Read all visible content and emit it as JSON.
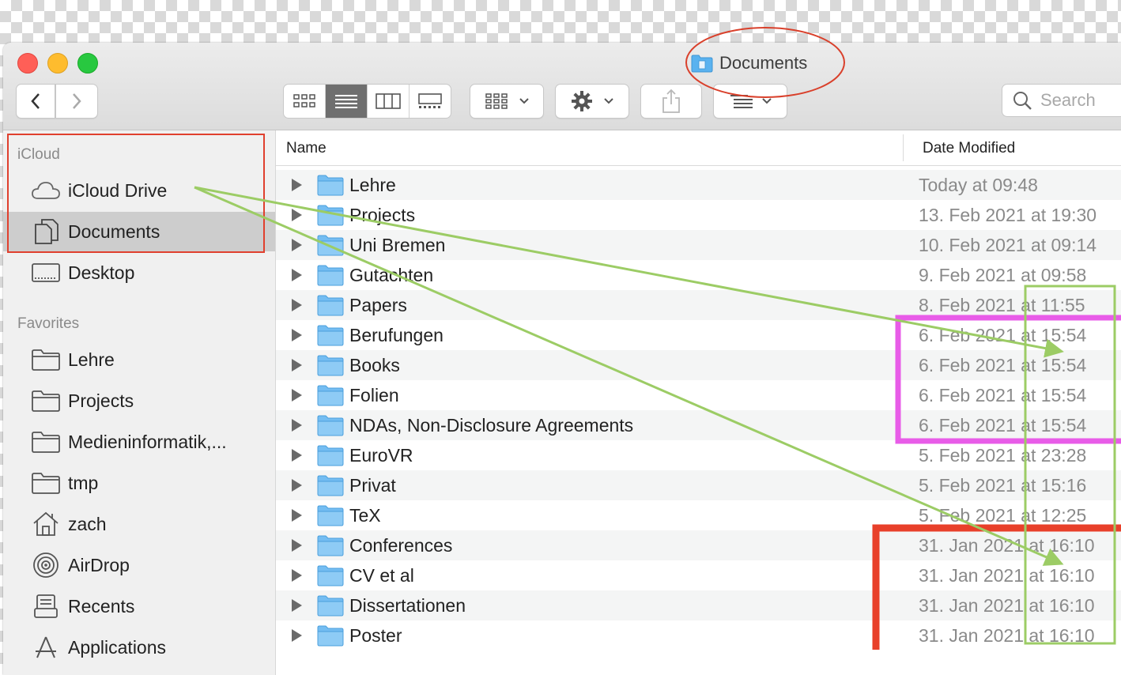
{
  "window": {
    "title": "Documents"
  },
  "toolbar": {
    "back_icon": "chevron-left-icon",
    "forward_icon": "chevron-right-icon",
    "view_modes": [
      "icon-view",
      "list-view",
      "column-view",
      "gallery-view"
    ],
    "search_placeholder": "Search"
  },
  "sidebar": {
    "icloud_header": "iCloud",
    "icloud_items": [
      {
        "label": "iCloud Drive",
        "icon": "cloud-icon"
      },
      {
        "label": "Documents",
        "icon": "documents-icon",
        "selected": true
      },
      {
        "label": "Desktop",
        "icon": "desktop-icon"
      }
    ],
    "favorites_header": "Favorites",
    "favorite_items": [
      {
        "label": "Lehre",
        "icon": "folder-icon"
      },
      {
        "label": "Projects",
        "icon": "folder-icon"
      },
      {
        "label": "Medieninformatik,...",
        "icon": "folder-icon"
      },
      {
        "label": "tmp",
        "icon": "folder-icon"
      },
      {
        "label": "zach",
        "icon": "home-icon"
      },
      {
        "label": "AirDrop",
        "icon": "airdrop-icon"
      },
      {
        "label": "Recents",
        "icon": "recents-icon"
      },
      {
        "label": "Applications",
        "icon": "applications-icon"
      }
    ]
  },
  "columns": {
    "name": "Name",
    "date_modified": "Date Modified"
  },
  "files": [
    {
      "name": "Lehre",
      "date": "Today at 09:48"
    },
    {
      "name": "Projects",
      "date": "13. Feb 2021 at 19:30"
    },
    {
      "name": "Uni Bremen",
      "date": "10. Feb 2021 at 09:14"
    },
    {
      "name": "Gutachten",
      "date": "9. Feb 2021 at 09:58"
    },
    {
      "name": "Papers",
      "date": "8. Feb 2021 at 11:55"
    },
    {
      "name": "Berufungen",
      "date": "6. Feb 2021 at 15:54"
    },
    {
      "name": "Books",
      "date": "6. Feb 2021 at 15:54"
    },
    {
      "name": "Folien",
      "date": "6. Feb 2021 at 15:54"
    },
    {
      "name": "NDAs, Non-Disclosure Agreements",
      "date": "6. Feb 2021 at 15:54"
    },
    {
      "name": "EuroVR",
      "date": "5. Feb 2021 at 23:28"
    },
    {
      "name": "Privat",
      "date": "5. Feb 2021 at 15:16"
    },
    {
      "name": "TeX",
      "date": "5. Feb 2021 at 12:25"
    },
    {
      "name": "Conferences",
      "date": "31. Jan 2021 at 16:10"
    },
    {
      "name": "CV et al",
      "date": "31. Jan 2021 at 16:10"
    },
    {
      "name": "Dissertationen",
      "date": "31. Jan 2021 at 16:10"
    },
    {
      "name": "Poster",
      "date": "31. Jan 2021 at 16:10"
    }
  ],
  "annotation_colors": {
    "title_circle": "#d9402b",
    "sidebar_box": "#e0402e",
    "arrows": "#9ccc65",
    "magenta_box": "#e85ce8",
    "red_box": "#e8402a"
  }
}
